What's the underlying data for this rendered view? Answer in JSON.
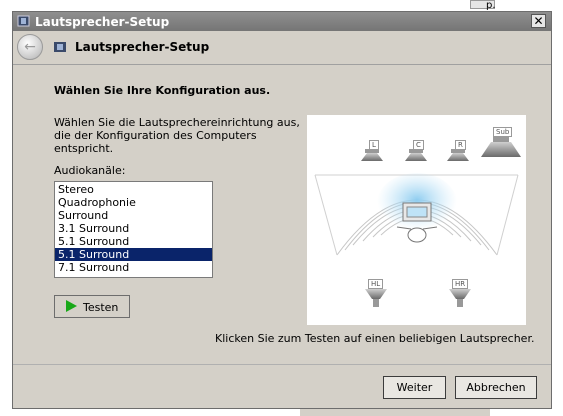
{
  "window": {
    "title": "Lautsprecher-Setup",
    "close_glyph": "✕"
  },
  "nav": {
    "back_glyph": "←",
    "title": "Lautsprecher-Setup"
  },
  "background": {
    "hook_text": "p."
  },
  "content": {
    "heading": "Wählen Sie Ihre Konfiguration aus.",
    "instructions": "Wählen Sie die Lautsprechereinrichtung aus, die der Konfiguration des Computers entspricht.",
    "channels_label": "Audiokanäle:",
    "channels": [
      "Stereo",
      "Quadrophonie",
      "Surround",
      "3.1 Surround",
      "5.1 Surround",
      "5.1 Surround",
      "7.1 Surround"
    ],
    "selected_index": 5,
    "test_label": "Testen",
    "hint": "Klicken Sie zum Testen auf einen beliebigen Lautsprecher."
  },
  "speakers": {
    "left": "L",
    "center": "C",
    "right": "R",
    "sub": "Sub",
    "rear_left": "HL",
    "rear_right": "HR"
  },
  "buttons": {
    "next": "Weiter",
    "cancel": "Abbrechen"
  },
  "colors": {
    "selection": "#0a246a",
    "test_arrow": "#18a818",
    "sound_wave": "#bfe3f7"
  }
}
